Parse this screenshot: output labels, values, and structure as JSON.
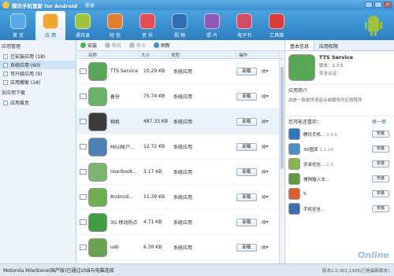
{
  "title": {
    "app": "腾讯手机管家 for Android",
    "login": "登录"
  },
  "nav": [
    {
      "label": "首 页",
      "color": "#56a8e6"
    },
    {
      "label": "应 用",
      "color": "#f2a531"
    },
    {
      "label": "通讯录",
      "color": "#9fc33c"
    },
    {
      "label": "短 信",
      "color": "#e07d2e"
    },
    {
      "label": "音 乐",
      "color": "#e24d56"
    },
    {
      "label": "视 频",
      "color": "#2f6fb8"
    },
    {
      "label": "照 片",
      "color": "#8e5bb4"
    },
    {
      "label": "电子书",
      "color": "#d24e64"
    },
    {
      "label": "工具箱",
      "color": "#d73e3e"
    }
  ],
  "left": {
    "section1": "应用管理",
    "items": [
      {
        "label": "已安装应用 (18)"
      },
      {
        "label": "系统应用 (60)"
      },
      {
        "label": "可升级应用 (9)"
      },
      {
        "label": "应用搬家 (18)"
      }
    ],
    "section2": "安应用下载",
    "items2": [
      {
        "label": "应用首页"
      }
    ]
  },
  "toolbar": {
    "install": "安装",
    "move": "移机",
    "mark": "移卡",
    "refresh": "刷新"
  },
  "table": {
    "headers": [
      "名称",
      "大小",
      "类型",
      "操作"
    ],
    "uninstall_label": "卸载",
    "rows": [
      {
        "name": "TTS Service",
        "size": "10.29 KB",
        "type": "系统应用",
        "color": "#5aa657"
      },
      {
        "name": "备份",
        "size": "75.74 KB",
        "type": "系统应用",
        "color": "#6ab26a"
      },
      {
        "name": "相机",
        "size": "487.33 KB",
        "type": "系统应用",
        "color": "#3b3b3b"
      },
      {
        "name": "MIUI账户...",
        "size": "12.72 KB",
        "type": "系统应用",
        "color": "#4e7fb5"
      },
      {
        "name": "Userbook...",
        "size": "3.17 KB",
        "type": "系统应用",
        "color": "#7bb56f"
      },
      {
        "name": "Android...",
        "size": "11.39 KB",
        "type": "系统应用",
        "color": "#6fae4e"
      },
      {
        "name": "3G 移动热点",
        "size": "4.71 KB",
        "type": "系统应用",
        "color": "#3f9e3f"
      },
      {
        "name": "usb",
        "size": "6.30 KB",
        "type": "系统应用",
        "color": "#6aa24f"
      }
    ]
  },
  "right": {
    "tabs": [
      "基本信息",
      "应用权限"
    ],
    "app_name": "TTS Service",
    "version": "版本：2.3.5",
    "security": "安全认证：",
    "intro_label": "应用简介",
    "intro": "这是一款提供语音合成服务的应用程序",
    "recommend_label": "您可能还喜欢：",
    "change": "换一换",
    "install_label": "安装",
    "recs": [
      {
        "name": "腾讯手机...",
        "ver": "3.4.6",
        "color": "#2b78c2"
      },
      {
        "name": "3D图库",
        "ver": "1.1.10",
        "color": "#4a8fcb"
      },
      {
        "name": "安卓优化...",
        "ver": "2.3",
        "color": "#8ab54a"
      },
      {
        "name": "搜狗输入法...",
        "ver": "",
        "color": "#5d9d3b"
      },
      {
        "name": "S",
        "ver": "",
        "color": "#e35c2c"
      },
      {
        "name": "手机安全...",
        "ver": "",
        "color": "#3c6db3"
      }
    ]
  },
  "status": {
    "device": "Motorola MileStone(国产版)已通过USB与电脑连接",
    "version": "版本1.0.301.1305(已是最新版本)"
  },
  "watermark": "Online"
}
